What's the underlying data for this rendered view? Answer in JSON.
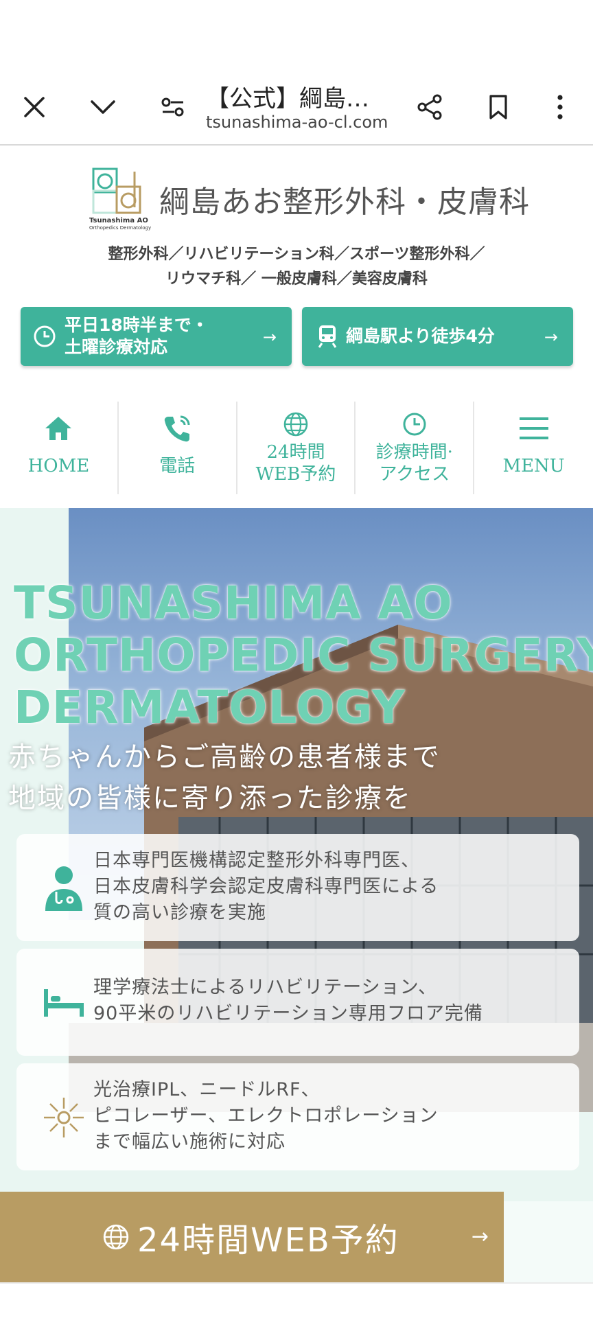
{
  "browser": {
    "title": "【公式】綱島あ…",
    "url": "tsunashima-ao-cl.com",
    "icons": [
      "close-icon",
      "chevron-down-icon",
      "site-settings-icon",
      "share-icon",
      "bookmark-icon",
      "more-vert-icon"
    ]
  },
  "header": {
    "logo_text_1": "Tsunashima AO",
    "logo_text_2": "Orthopedics Dermatology",
    "clinic_name": "綱島あお整形外科・皮膚科",
    "departments_line1": "整形外科／リハビリテーション科／スポーツ整形外科／",
    "departments_line2": "リウマチ科／ 一般皮膚科／美容皮膚科"
  },
  "info_buttons": [
    {
      "line1": "平日18時半まで・",
      "line2": "土曜診療対応",
      "icon": "clock-icon",
      "arrow": "→"
    },
    {
      "label": "綱島駅より徒歩4分",
      "icon": "train-icon",
      "arrow": "→"
    }
  ],
  "nav": [
    {
      "label": "HOME",
      "icon": "home-icon"
    },
    {
      "label": "電話",
      "icon": "phone-icon"
    },
    {
      "label1": "24時間",
      "label2": "WEB予約",
      "icon": "globe-icon"
    },
    {
      "label1": "診療時間·",
      "label2": "アクセス",
      "icon": "clock-icon"
    },
    {
      "label": "MENU",
      "icon": "hamburger-icon"
    }
  ],
  "hero": {
    "title_line1": "TSUNASHIMA AO",
    "title_line2": "ORTHOPEDIC SURGERY",
    "title_line3": "DERMATOLOGY",
    "sub_line1": "赤ちゃんからご高齢の患者様まで",
    "sub_line2": "地域の皆様に寄り添った診療を"
  },
  "features": [
    {
      "icon": "doctor-icon",
      "line1": "日本専門医機構認定整形外科専門医、",
      "line2": "日本皮膚科学会認定皮膚科専門医による",
      "line3": "質の高い診療を実施"
    },
    {
      "icon": "bed-icon",
      "line1": "理学療法士によるリハビリテーション、",
      "line2": "90平米のリハビリテーション専用フロア完備"
    },
    {
      "icon": "sparkle-icon",
      "line1": "光治療IPL、ニードルRF、",
      "line2": "ピコレーザー、エレクトロポレーション",
      "line3": "まで幅広い施術に対応"
    }
  ],
  "cta": {
    "label": "24時間WEB予約",
    "arrow": "→",
    "icon": "globe-icon"
  },
  "colors": {
    "teal": "#3fb39b",
    "gold": "#b89c63",
    "text": "#555555"
  }
}
